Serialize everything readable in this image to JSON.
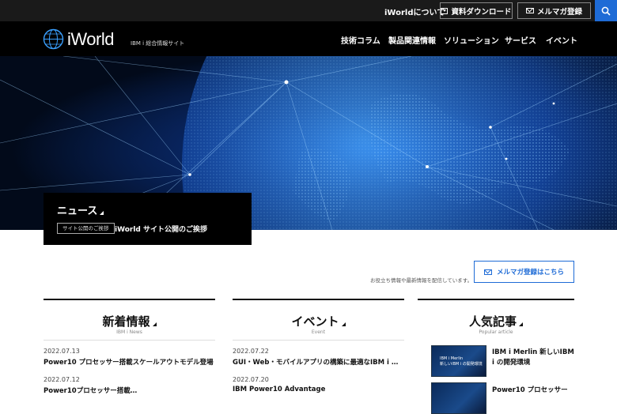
{
  "topbar": {
    "about": "iWorldについて",
    "download_label": "資料ダウンロード",
    "mailmag_label": "メルマガ登録"
  },
  "header": {
    "logo_text": "iWorld",
    "logo_sub": "IBM i 総合情報サイト",
    "nav": [
      "技術コラム",
      "製品関連情報",
      "ソリューション",
      "サービス",
      "イベント"
    ]
  },
  "news": {
    "title": "ニュース",
    "tag": "サイト公開のご挨拶",
    "headline": "iWorld サイト公開のご挨拶"
  },
  "register": {
    "note": "お役立ち情報や最新情報を配信しています。",
    "button": "メルマガ登録はこちら"
  },
  "columns": {
    "news": {
      "title": "新着情報",
      "sub": "IBM i News",
      "items": [
        {
          "date": "2022.07.13",
          "text": "Power10 プロセッサー搭載スケールアウトモデル登場"
        },
        {
          "date": "2022.07.12",
          "text": "Power10プロセッサー搭載…"
        }
      ]
    },
    "event": {
      "title": "イベント",
      "sub": "Event",
      "items": [
        {
          "date": "2022.07.22",
          "text": "GUI・Web・モバイルアプリの構築に最適なIBM i …"
        },
        {
          "date": "2022.07.20",
          "text": "IBM Power10 Advantage"
        }
      ]
    },
    "popular": {
      "title": "人気記事",
      "sub": "Popular article",
      "items": [
        {
          "thumb_caption_1": "IBM i Merlin",
          "thumb_caption_2": "新しいIBM i の開発環境",
          "line1": "IBM i Merlin 新しいIBM",
          "line2": "i の開発環境"
        },
        {
          "line1": "Power10 プロセッサー"
        }
      ]
    }
  },
  "colors": {
    "accent": "#1e6bd6",
    "topbar": "#1a1a1a",
    "header": "#000000"
  }
}
